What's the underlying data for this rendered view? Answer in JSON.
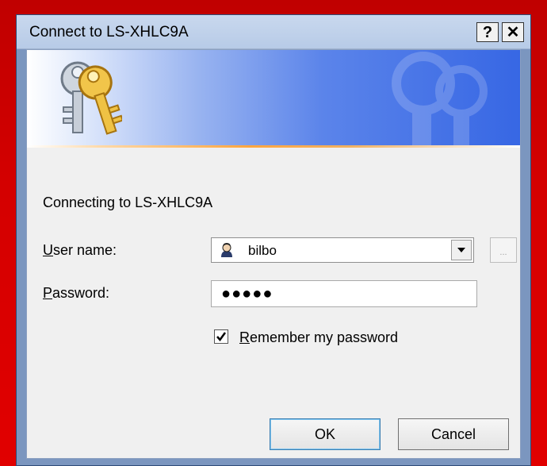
{
  "window": {
    "title": "Connect to LS-XHLC9A",
    "help_label": "?",
    "close_label": "✕"
  },
  "banner": {
    "icon": "keys-icon",
    "watermark_icon": "keys-watermark-icon"
  },
  "form": {
    "connecting_text": "Connecting to LS-XHLC9A",
    "username_label_key": "U",
    "username_label_rest": "ser name:",
    "username_value": "bilbo",
    "username_icon": "user-avatar-icon",
    "browse_label": "...",
    "password_label_key": "P",
    "password_label_rest": "assword:",
    "password_mask": "●●●●●",
    "remember_checked": true,
    "remember_label_key": "R",
    "remember_label_rest": "emember my password"
  },
  "buttons": {
    "ok_label": "OK",
    "cancel_label": "Cancel"
  },
  "colors": {
    "background": "#d40000",
    "banner_accent": "#3767e4",
    "banner_line": "#ffa640"
  }
}
